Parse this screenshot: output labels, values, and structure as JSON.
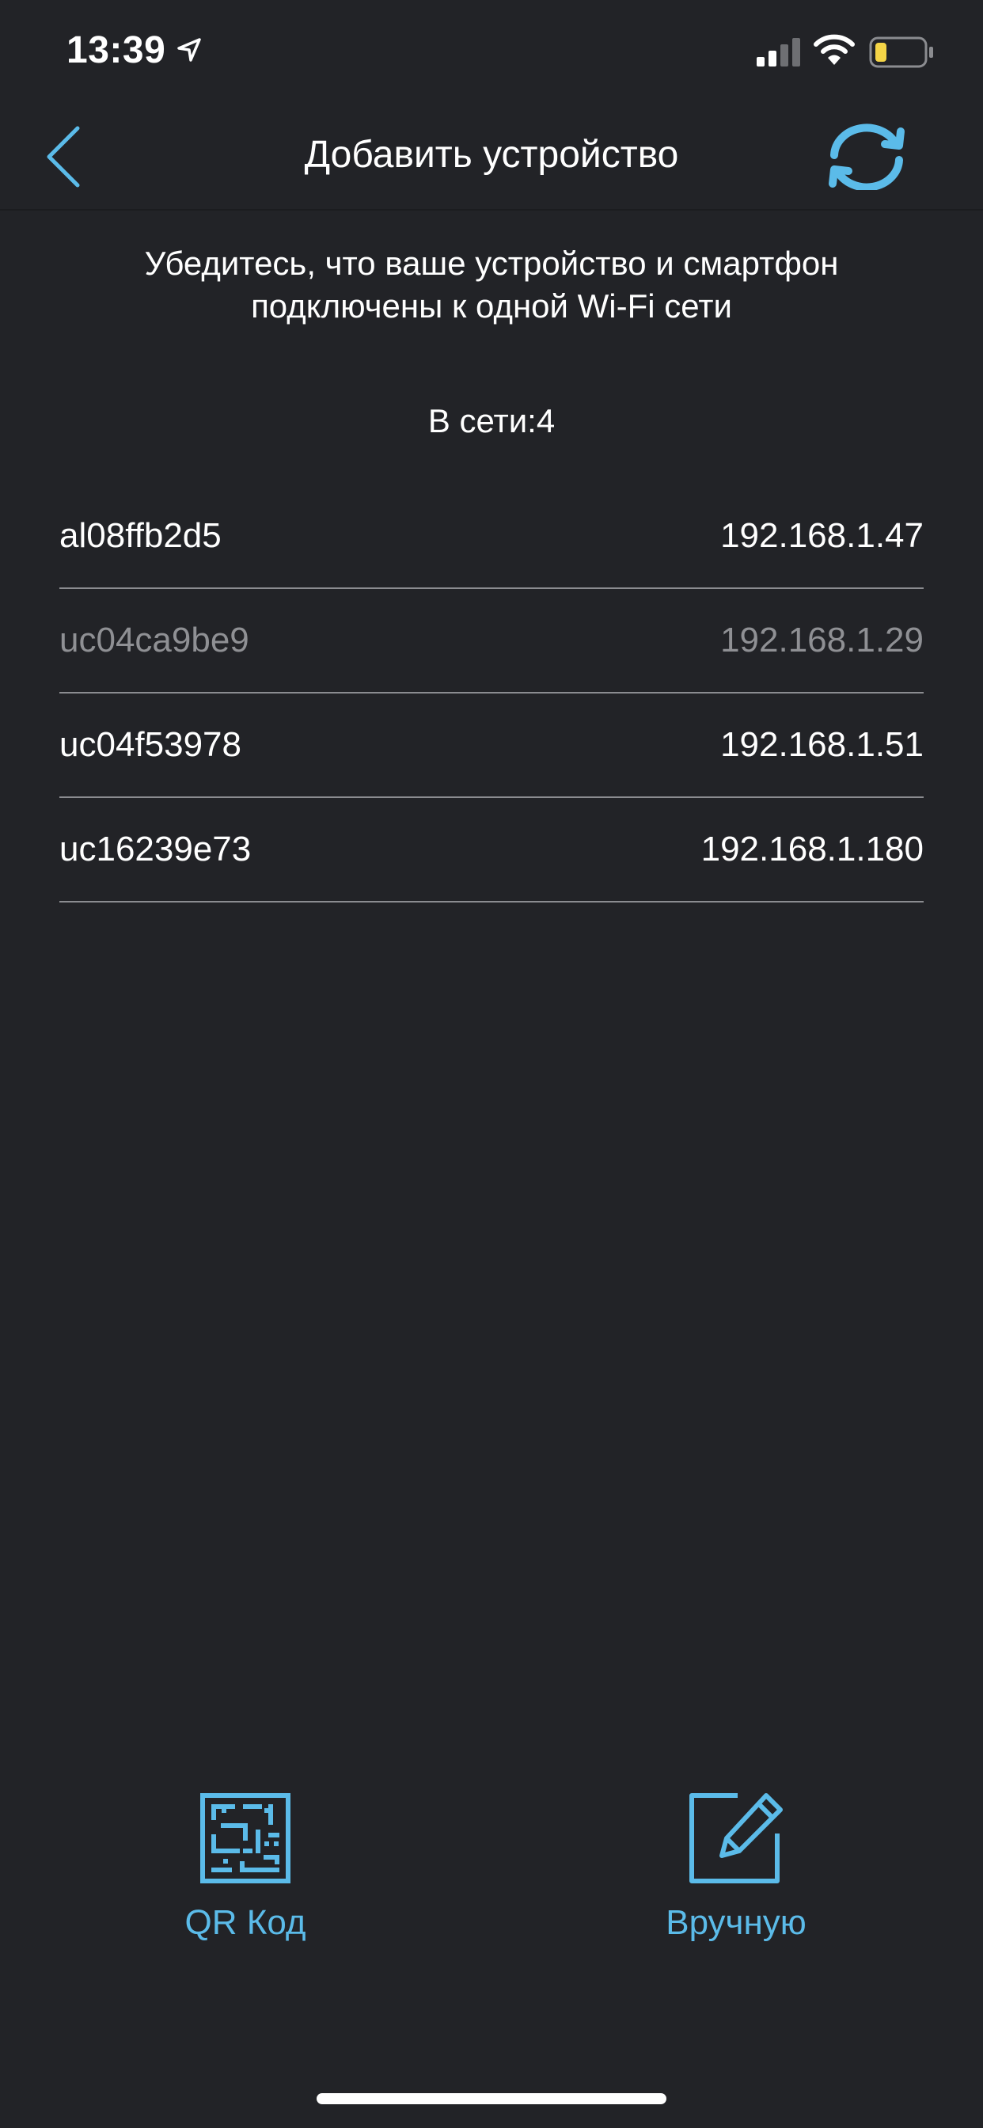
{
  "status_bar": {
    "time": "13:39",
    "icons": [
      "location-arrow-icon",
      "cellular-signal-icon",
      "wifi-icon",
      "battery-low-icon"
    ]
  },
  "header": {
    "title": "Добавить устройство",
    "back_icon": "chevron-left-icon",
    "refresh_icon": "refresh-icon"
  },
  "instruction": {
    "line1": "Убедитесь, что ваше устройство и смартфон",
    "line2": "подключены к одной Wi-Fi сети"
  },
  "online": {
    "label": "В сети:4"
  },
  "devices": [
    {
      "name": "al08ffb2d5",
      "ip": "192.168.1.47"
    },
    {
      "name": "uc04ca9be9",
      "ip": "192.168.1.29"
    },
    {
      "name": "uc04f53978",
      "ip": "192.168.1.51"
    },
    {
      "name": "uc16239e73",
      "ip": "192.168.1.180"
    }
  ],
  "actions": {
    "qr": {
      "label": "QR Код",
      "icon": "qr-code-icon"
    },
    "manual": {
      "label": "Вручную",
      "icon": "edit-pencil-icon"
    }
  },
  "colors": {
    "background": "#222327",
    "accent": "#5bbbe9",
    "text": "#ffffff",
    "text_dim": "#8f9094",
    "divider": "#8b8c90",
    "battery_level": "#f5d547"
  }
}
